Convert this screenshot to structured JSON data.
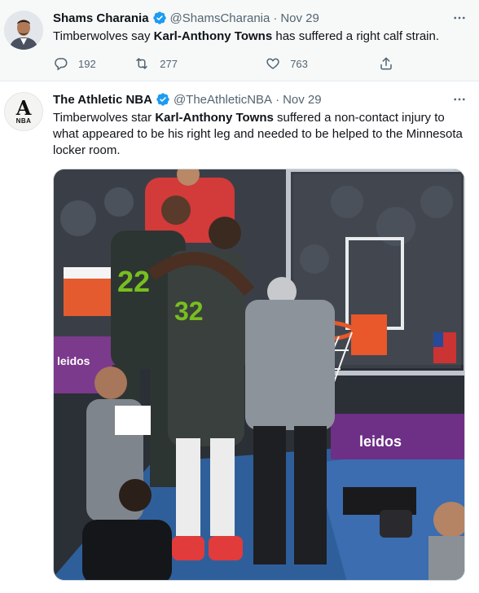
{
  "tweets": [
    {
      "author_name": "Shams Charania",
      "handle": "@ShamsCharania",
      "separator": "·",
      "date": "Nov 29",
      "text_before": "Timberwolves say ",
      "text_bold": "Karl-Anthony Towns",
      "text_after": " has suffered a right calf strain.",
      "replies": "192",
      "retweets": "277",
      "likes": "763",
      "verified": true,
      "more_icon": "more-horizontal-icon"
    },
    {
      "author_name": "The Athletic NBA",
      "handle": "@TheAthleticNBA",
      "separator": "·",
      "date": "Nov 29",
      "text_before": "Timberwolves star ",
      "text_bold": "Karl-Anthony Towns",
      "text_after": " suffered a non-contact injury to what appeared to be his right leg and needed to be helped to the Minnesota locker room.",
      "avatar_logo": {
        "letter": "A",
        "sub": "NBA"
      },
      "verified": true,
      "media": {
        "type": "photo",
        "jersey_numbers": [
          "22",
          "32"
        ],
        "court_banner_text": "leidos"
      }
    }
  ],
  "colors": {
    "verified_blue": "#1d9bf0",
    "secondary_text": "#536471",
    "highlight_bg": "#f7f9f9",
    "jersey_green": "#78be20"
  },
  "icons": {
    "reply": "reply-icon",
    "retweet": "retweet-icon",
    "like": "heart-icon",
    "share": "share-icon",
    "verified": "verified-badge-icon"
  }
}
